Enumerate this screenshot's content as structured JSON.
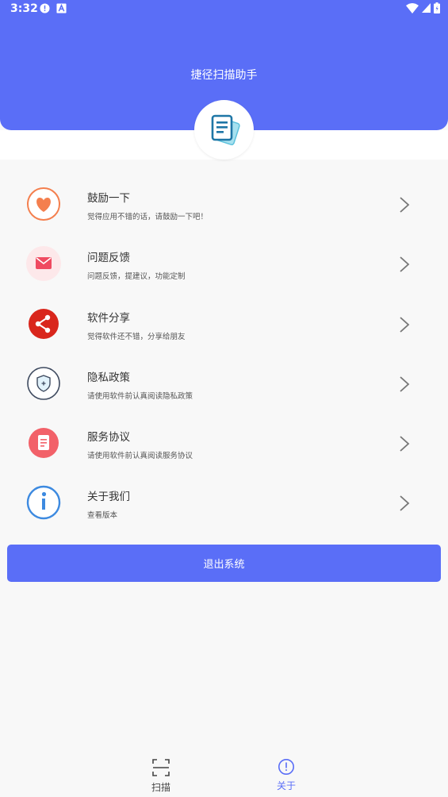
{
  "status_bar": {
    "time": "3:32",
    "left_icons": [
      "alert-circle-icon",
      "a-notification-icon"
    ],
    "right_icons": [
      "wifi-icon",
      "signal-icon",
      "battery-icon"
    ]
  },
  "header": {
    "title": "捷径扫描助手",
    "color": "#5a6ef7",
    "logo_icon": "document-cards-icon"
  },
  "menu": {
    "items": [
      {
        "title": "鼓励一下",
        "subtitle": "觉得应用不错的话，请鼓励一下吧！",
        "icon": "heart-icon",
        "color": "#f47f4e"
      },
      {
        "title": "问题反馈",
        "subtitle": "问题反馈，提建议，功能定制",
        "icon": "mail-icon",
        "color": "#ef4a61"
      },
      {
        "title": "软件分享",
        "subtitle": "觉得软件还不错，分享给朋友",
        "icon": "share-icon",
        "color": "#d9261c"
      },
      {
        "title": "隐私政策",
        "subtitle": "请使用软件前认真阅读隐私政策",
        "icon": "shield-icon",
        "color": "#3e4a5f"
      },
      {
        "title": "服务协议",
        "subtitle": "请使用软件前认真阅读服务协议",
        "icon": "agreement-doc-icon",
        "color": "#f26169"
      },
      {
        "title": "关于我们",
        "subtitle": "查看版本",
        "icon": "info-icon",
        "color": "#3d8ae0"
      }
    ]
  },
  "logout_label": "退出系统",
  "bottom_nav": {
    "items": [
      {
        "label": "扫描",
        "icon": "scan-frame-icon",
        "active": false
      },
      {
        "label": "关于",
        "icon": "info-circle-icon",
        "active": true
      }
    ],
    "active_color": "#5a6ef7",
    "inactive_color": "#444444"
  }
}
